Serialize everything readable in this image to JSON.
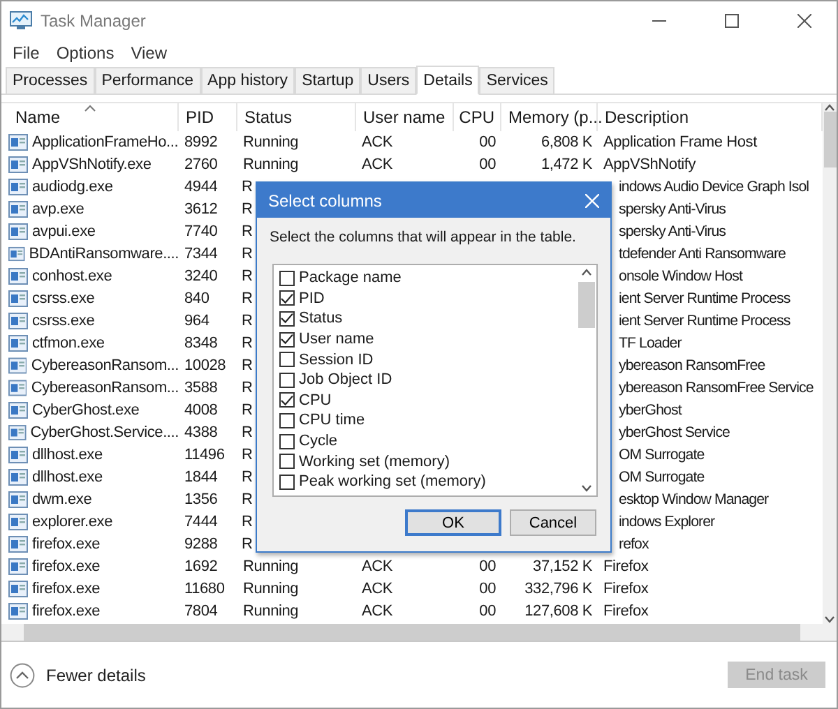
{
  "window": {
    "title": "Task Manager"
  },
  "menu": [
    "File",
    "Options",
    "View"
  ],
  "tabs": [
    {
      "label": "Processes",
      "selected": false
    },
    {
      "label": "Performance",
      "selected": false
    },
    {
      "label": "App history",
      "selected": false
    },
    {
      "label": "Startup",
      "selected": false
    },
    {
      "label": "Users",
      "selected": false
    },
    {
      "label": "Details",
      "selected": true
    },
    {
      "label": "Services",
      "selected": false
    }
  ],
  "table": {
    "columns": [
      "Name",
      "PID",
      "Status",
      "User name",
      "CPU",
      "Memory (p...",
      "Description"
    ],
    "rows": [
      {
        "kind": "full",
        "name": "ApplicationFrameHo...",
        "pid": "8992",
        "status": "Running",
        "user": "ACK",
        "cpu": "00",
        "memory": "6,808 K",
        "description": "Application Frame Host"
      },
      {
        "kind": "full",
        "name": "AppVShNotify.exe",
        "pid": "2760",
        "status": "Running",
        "user": "ACK",
        "cpu": "00",
        "memory": "1,472 K",
        "description": "AppVShNotify"
      },
      {
        "kind": "covered",
        "name": "audiodg.exe",
        "pid": "4944",
        "status": "R",
        "description": "indows Audio Device Graph Isol"
      },
      {
        "kind": "covered",
        "name": "avp.exe",
        "pid": "3612",
        "status": "R",
        "description": "spersky Anti-Virus"
      },
      {
        "kind": "covered",
        "name": "avpui.exe",
        "pid": "7740",
        "status": "R",
        "description": "spersky Anti-Virus"
      },
      {
        "kind": "covered",
        "name": "BDAntiRansomware....",
        "pid": "7344",
        "status": "R",
        "description": "tdefender Anti Ransomware"
      },
      {
        "kind": "covered",
        "name": "conhost.exe",
        "pid": "3240",
        "status": "R",
        "description": "onsole Window Host"
      },
      {
        "kind": "covered",
        "name": "csrss.exe",
        "pid": "840",
        "status": "R",
        "description": "ient Server Runtime Process"
      },
      {
        "kind": "covered",
        "name": "csrss.exe",
        "pid": "964",
        "status": "R",
        "description": "ient Server Runtime Process"
      },
      {
        "kind": "covered",
        "name": "ctfmon.exe",
        "pid": "8348",
        "status": "R",
        "description": "TF Loader"
      },
      {
        "kind": "covered",
        "name": "CybereasonRansom...",
        "pid": "10028",
        "status": "R",
        "description": "ybereason RansomFree"
      },
      {
        "kind": "covered",
        "name": "CybereasonRansom...",
        "pid": "3588",
        "status": "R",
        "description": "ybereason RansomFree Service"
      },
      {
        "kind": "covered",
        "name": "CyberGhost.exe",
        "pid": "4008",
        "status": "R",
        "description": "yberGhost"
      },
      {
        "kind": "covered",
        "name": "CyberGhost.Service....",
        "pid": "4388",
        "status": "R",
        "description": "yberGhost Service"
      },
      {
        "kind": "covered",
        "name": "dllhost.exe",
        "pid": "11496",
        "status": "R",
        "description": "OM Surrogate"
      },
      {
        "kind": "covered",
        "name": "dllhost.exe",
        "pid": "1844",
        "status": "R",
        "description": "OM Surrogate"
      },
      {
        "kind": "covered",
        "name": "dwm.exe",
        "pid": "1356",
        "status": "R",
        "description": "esktop Window Manager"
      },
      {
        "kind": "covered",
        "name": "explorer.exe",
        "pid": "7444",
        "status": "R",
        "description": "indows Explorer"
      },
      {
        "kind": "covered",
        "name": "firefox.exe",
        "pid": "9288",
        "status": "R",
        "description": "refox"
      },
      {
        "kind": "full",
        "name": "firefox.exe",
        "pid": "1692",
        "status": "Running",
        "user": "ACK",
        "cpu": "00",
        "memory": "37,152 K",
        "description": "Firefox"
      },
      {
        "kind": "full",
        "name": "firefox.exe",
        "pid": "11680",
        "status": "Running",
        "user": "ACK",
        "cpu": "00",
        "memory": "332,796 K",
        "description": "Firefox"
      },
      {
        "kind": "full",
        "name": "firefox.exe",
        "pid": "7804",
        "status": "Running",
        "user": "ACK",
        "cpu": "00",
        "memory": "127,608 K",
        "description": "Firefox"
      }
    ]
  },
  "dialog": {
    "title": "Select columns",
    "message": "Select the columns that will appear in the table.",
    "options": [
      {
        "label": "Package name",
        "checked": false
      },
      {
        "label": "PID",
        "checked": true
      },
      {
        "label": "Status",
        "checked": true
      },
      {
        "label": "User name",
        "checked": true
      },
      {
        "label": "Session ID",
        "checked": false
      },
      {
        "label": "Job Object ID",
        "checked": false
      },
      {
        "label": "CPU",
        "checked": true
      },
      {
        "label": "CPU time",
        "checked": false
      },
      {
        "label": "Cycle",
        "checked": false
      },
      {
        "label": "Working set (memory)",
        "checked": false
      },
      {
        "label": "Peak working set (memory)",
        "checked": false
      }
    ],
    "buttons": [
      "OK",
      "Cancel"
    ]
  },
  "footer": {
    "toggle": "Fewer details",
    "end_task": {
      "label": "End task",
      "disabled": true
    }
  }
}
